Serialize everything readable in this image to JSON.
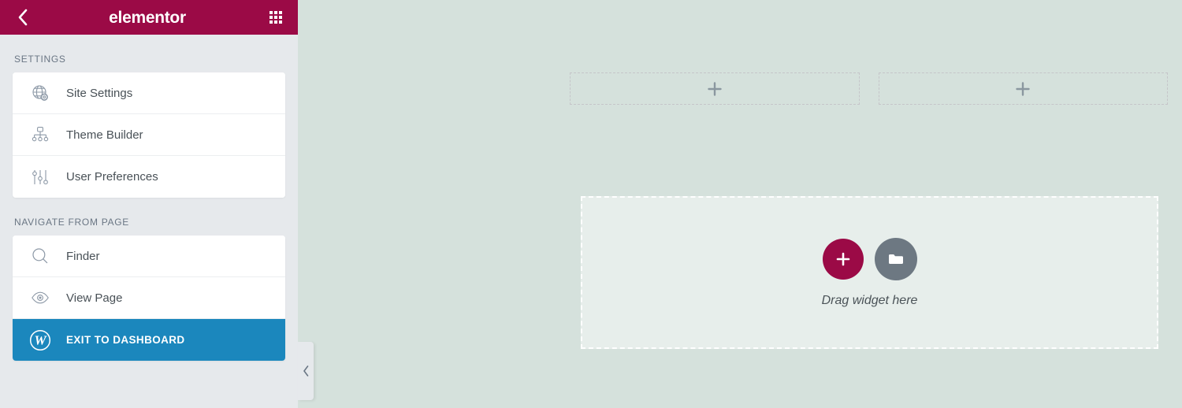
{
  "panel": {
    "header": {
      "back_icon": "chevron-left-icon",
      "logo_text": "elementor",
      "grid_icon": "apps-grid-icon"
    },
    "sections": [
      {
        "label": "SETTINGS",
        "items": [
          {
            "label": "Site Settings",
            "icon": "globe-gear-icon",
            "highlight": false
          },
          {
            "label": "Theme Builder",
            "icon": "sitemap-icon",
            "highlight": false
          },
          {
            "label": "User Preferences",
            "icon": "sliders-icon",
            "highlight": false
          }
        ]
      },
      {
        "label": "NAVIGATE FROM PAGE",
        "items": [
          {
            "label": "Finder",
            "icon": "search-icon",
            "highlight": false
          },
          {
            "label": "View Page",
            "icon": "eye-icon",
            "highlight": false
          },
          {
            "label": "EXIT TO DASHBOARD",
            "icon": "wordpress-icon",
            "highlight": true
          }
        ]
      }
    ],
    "collapse_handle_icon": "chevron-left-icon"
  },
  "canvas": {
    "add_sections": [
      {
        "icon": "plus-icon"
      },
      {
        "icon": "plus-icon"
      }
    ],
    "drop_zone": {
      "add_widget_icon": "plus-icon",
      "template_library_icon": "folder-icon",
      "text": "Drag widget here"
    }
  },
  "colors": {
    "brand": "#9b0a46",
    "highlight": "#1b87bd",
    "panel_bg": "#e6e9ec",
    "canvas_bg": "#d5e1dc",
    "drop_zone_bg": "#e7eeeb",
    "text": "#495157",
    "muted": "#6a7684"
  }
}
